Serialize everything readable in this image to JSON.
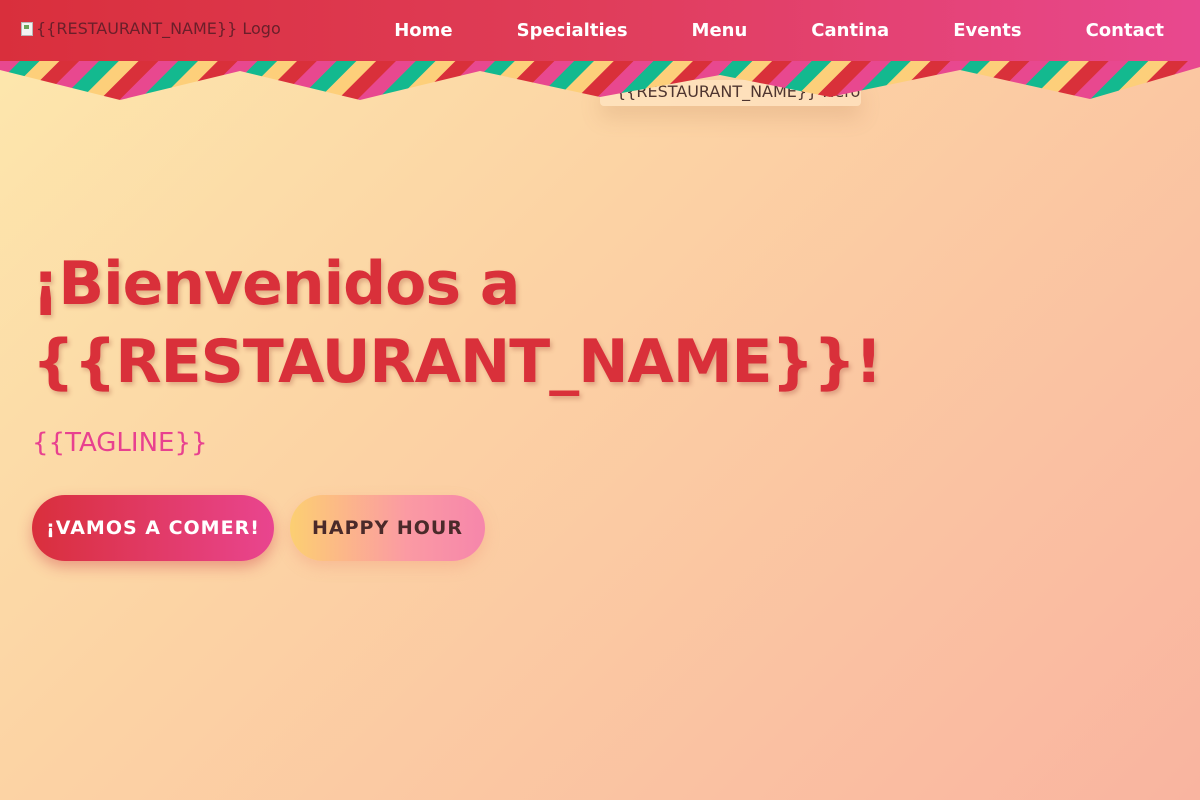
{
  "header": {
    "logo_alt": "{{RESTAURANT_NAME}} Logo",
    "nav": [
      {
        "label": "Home"
      },
      {
        "label": "Specialties"
      },
      {
        "label": "Menu"
      },
      {
        "label": "Cantina"
      },
      {
        "label": "Events"
      },
      {
        "label": "Contact"
      }
    ]
  },
  "banner": {
    "colors": [
      "#e8488f",
      "#13b98f",
      "#fdcf7a",
      "#d9303a"
    ]
  },
  "hero": {
    "image_alt": "{{RESTAURANT_NAME}} Hero",
    "title_line1": "¡Bienvenidos a",
    "title_line2": "{{RESTAURANT_NAME}}!",
    "tagline": "{{TAGLINE}}",
    "primary_button": "¡VAMOS A COMER!",
    "secondary_button": "HAPPY HOUR"
  },
  "colors": {
    "primary": "#d9303a",
    "accent_pink": "#e8488f",
    "accent_teal": "#13b98f",
    "accent_yellow": "#fdcf7a"
  }
}
